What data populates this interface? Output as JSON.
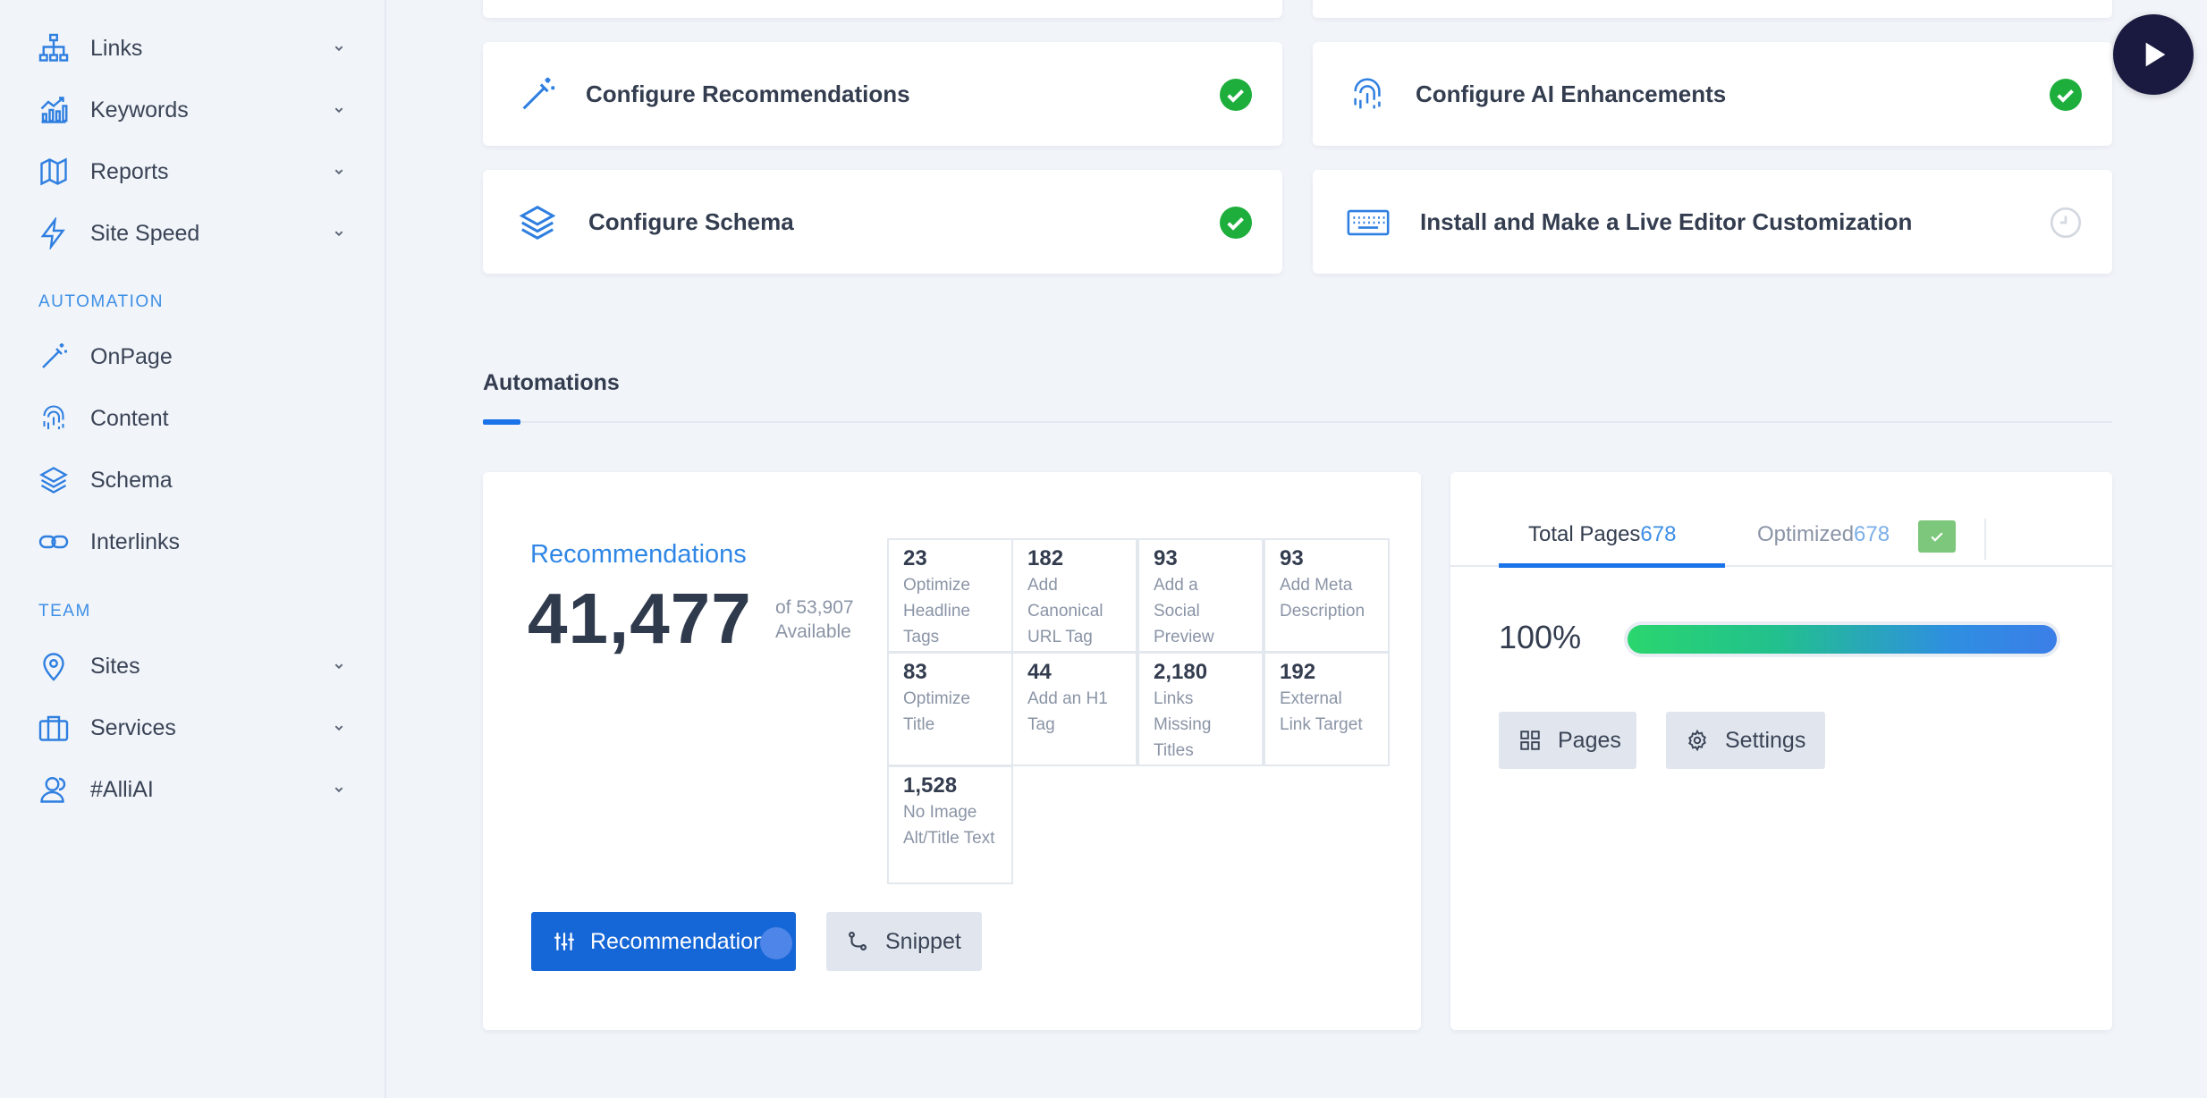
{
  "sidebar": {
    "nav_top": [
      {
        "label": "Links",
        "icon": "sitemap-icon"
      },
      {
        "label": "Keywords",
        "icon": "chart-line-icon"
      },
      {
        "label": "Reports",
        "icon": "map-icon"
      },
      {
        "label": "Site Speed",
        "icon": "bolt-icon"
      }
    ],
    "automation_title": "AUTOMATION",
    "nav_automation": [
      {
        "label": "OnPage",
        "icon": "magic-wand-icon"
      },
      {
        "label": "Content",
        "icon": "fingerprint-icon"
      },
      {
        "label": "Schema",
        "icon": "layers-icon"
      },
      {
        "label": "Interlinks",
        "icon": "link-icon"
      }
    ],
    "team_title": "TEAM",
    "nav_team": [
      {
        "label": "Sites",
        "icon": "map-pin-icon"
      },
      {
        "label": "Services",
        "icon": "briefcase-icon"
      },
      {
        "label": "#AlliAI",
        "icon": "user-group-icon"
      }
    ]
  },
  "tasks": [
    {
      "title": "Configure Recommendations",
      "icon": "magic-wand-icon",
      "status": "done"
    },
    {
      "title": "Configure AI Enhancements",
      "icon": "fingerprint-icon",
      "status": "done"
    },
    {
      "title": "Configure Schema",
      "icon": "layers-icon",
      "status": "done"
    },
    {
      "title": "Install and Make a Live Editor Customization",
      "icon": "keyboard-icon",
      "status": "pending"
    }
  ],
  "automations": {
    "tab_label": "Automations",
    "recommendations": {
      "title": "Recommendations",
      "count": "41,477",
      "of_label": "of 53,907",
      "available_label": "Available",
      "items": [
        {
          "num": "23",
          "desc": "Optimize Headline Tags"
        },
        {
          "num": "182",
          "desc": "Add Canonical URL Tag"
        },
        {
          "num": "93",
          "desc": "Add a Social Preview"
        },
        {
          "num": "93",
          "desc": "Add Meta Description"
        },
        {
          "num": "83",
          "desc": "Optimize Title"
        },
        {
          "num": "44",
          "desc": "Add an H1 Tag"
        },
        {
          "num": "2,180",
          "desc": "Links Missing Titles"
        },
        {
          "num": "192",
          "desc": "External Link Target"
        },
        {
          "num": "1,528",
          "desc": "No Image Alt/Title Text"
        }
      ],
      "primary_button": "Recommendations",
      "secondary_button": "Snippet"
    },
    "pages": {
      "tab_total_label": "Total Pages",
      "tab_total_count": "678",
      "tab_optimized_label": "Optimized",
      "tab_optimized_count": "678",
      "percent_label": "100%",
      "progress": 1.0,
      "pages_button": "Pages",
      "settings_button": "Settings"
    }
  },
  "colors": {
    "accent": "#1a73e8",
    "success": "#1eae3c",
    "sidebar_icon": "#2f7fe0"
  }
}
